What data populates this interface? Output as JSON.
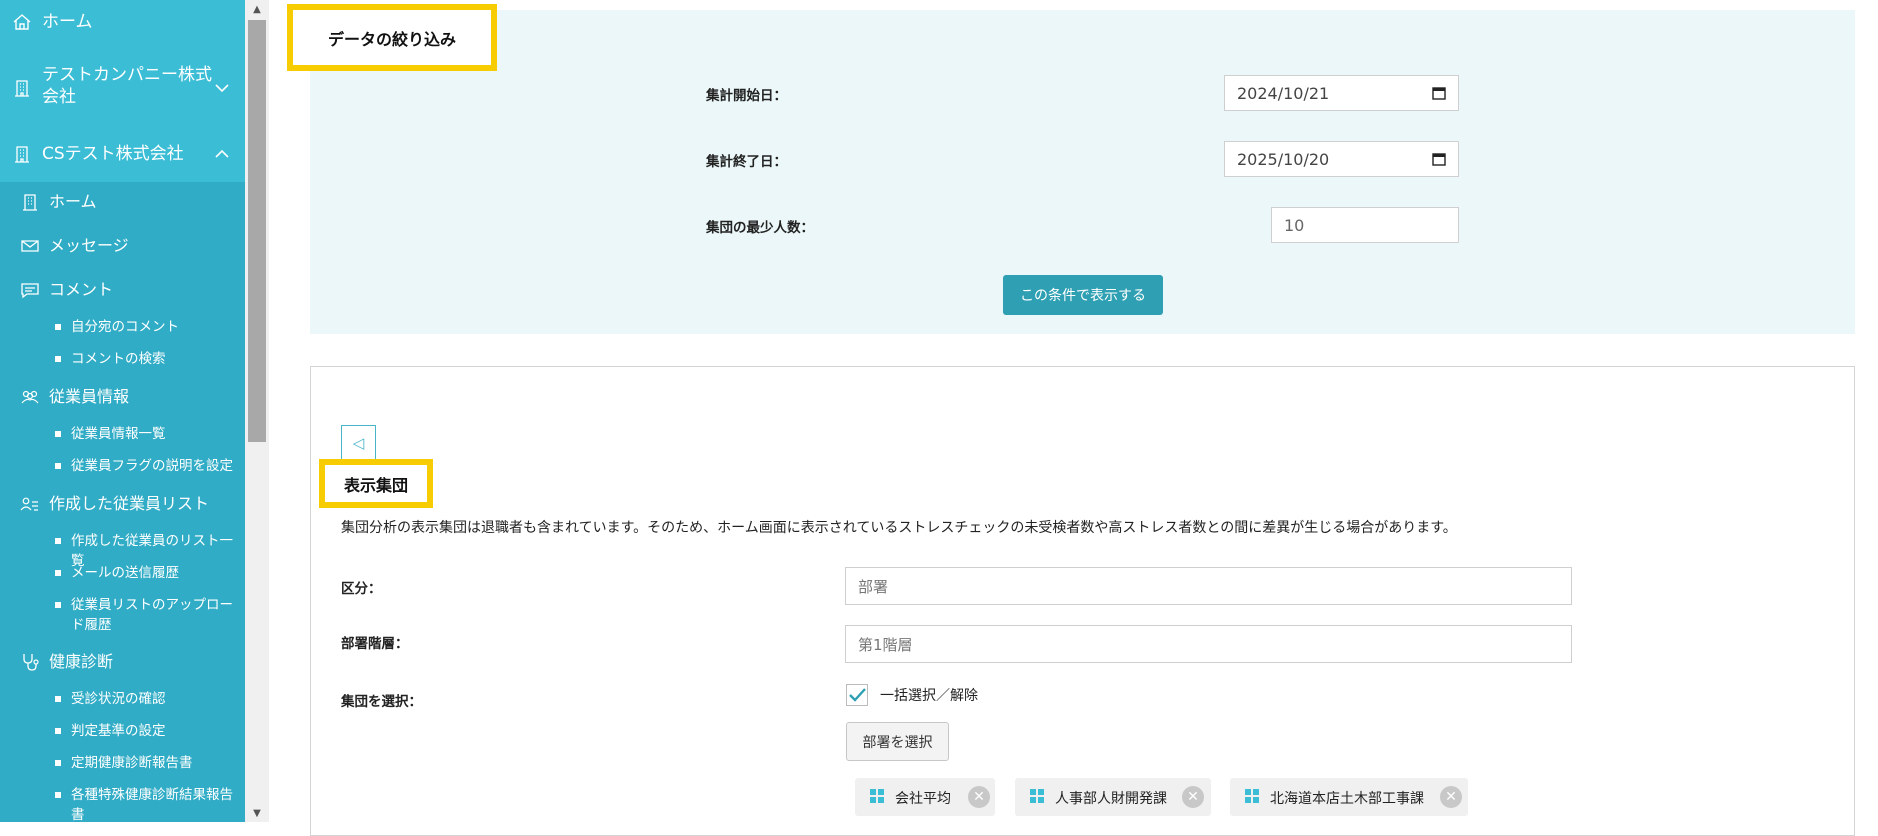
{
  "sidebar": {
    "top_items": [
      {
        "label": "ホーム",
        "icon": "home-icon"
      },
      {
        "label": "テストカンパニー株式会社",
        "icon": "building-icon"
      },
      {
        "label": "CSテスト株式会社",
        "icon": "building-icon"
      }
    ],
    "sub_items": [
      {
        "label": "ホーム",
        "icon": "building-icon"
      },
      {
        "label": "メッセージ",
        "icon": "envelope-icon"
      },
      {
        "label": "コメント",
        "icon": "comment-icon"
      },
      {
        "label": "従業員情報",
        "icon": "people-icon"
      },
      {
        "label": "作成した従業員リスト",
        "icon": "user-list-icon"
      },
      {
        "label": "健康診断",
        "icon": "stethoscope-icon"
      }
    ],
    "leaves": [
      "自分宛のコメント",
      "コメントの検索",
      "従業員情報一覧",
      "従業員フラグの説明を設定",
      "作成した従業員のリスト一覧",
      "メールの送信履歴",
      "従業員リストのアップロード履歴",
      "受診状況の確認",
      "判定基準の設定",
      "定期健康診断報告書",
      "各種特殊健康診断結果報告書"
    ]
  },
  "filter": {
    "title": "データの絞り込み",
    "start_label": "集計開始日：",
    "start_value": "2024/10/21",
    "end_label": "集計終了日：",
    "end_value": "2025/10/20",
    "min_label": "集団の最少人数：",
    "min_value": "10",
    "submit_label": "この条件で表示する"
  },
  "groups": {
    "collapse_glyph": "◁",
    "title": "表示集団",
    "notice": "集団分析の表示集団は退職者も含まれています。そのため、ホーム画面に表示されているストレスチェックの未受検者数や高ストレス者数との間に差異が生じる場合があります。",
    "category_label": "区分：",
    "category_value": "部署",
    "level_label": "部署階層：",
    "level_value": "第1階層",
    "select_label": "集団を選択：",
    "bulk_label": "一括選択／解除",
    "dept_button": "部署を選択",
    "tags": [
      "会社平均",
      "人事部人財開発課",
      "北海道本店土木部工事課"
    ]
  },
  "colors": {
    "sidebar_bg": "#3bbdd6",
    "sidebar_sub_bg": "#31acc6",
    "accent_button": "#2fa0b3",
    "highlight_border": "#f7cc00",
    "filter_bg": "#ebf7f8"
  }
}
